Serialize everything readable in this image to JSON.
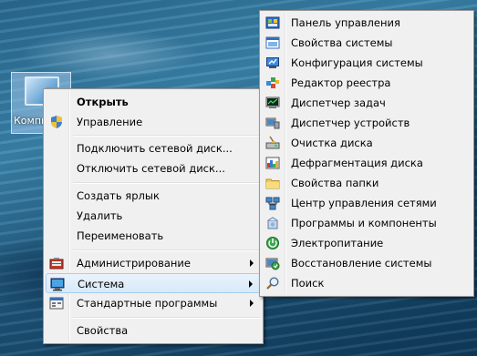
{
  "desktop": {
    "icon_label": "Компьютер"
  },
  "context_menu": {
    "items": [
      {
        "label": "Открыть",
        "bold": true
      },
      {
        "label": "Управление",
        "icon": "shield-icon"
      },
      {
        "label": "Подключить сетевой диск..."
      },
      {
        "label": "Отключить сетевой диск..."
      },
      {
        "label": "Создать ярлык"
      },
      {
        "label": "Удалить"
      },
      {
        "label": "Переименовать"
      },
      {
        "label": "Администрирование",
        "icon": "admin-tools-icon",
        "submenu": true
      },
      {
        "label": "Система",
        "icon": "system-icon",
        "submenu": true,
        "highlighted": true
      },
      {
        "label": "Стандартные программы",
        "icon": "accessories-icon",
        "submenu": true
      },
      {
        "label": "Свойства"
      }
    ]
  },
  "system_submenu": {
    "items": [
      {
        "label": "Панель управления",
        "icon": "control-panel-icon"
      },
      {
        "label": "Свойства системы",
        "icon": "system-properties-icon"
      },
      {
        "label": "Конфигурация системы",
        "icon": "msconfig-icon"
      },
      {
        "label": "Редактор реестра",
        "icon": "registry-editor-icon"
      },
      {
        "label": "Диспетчер задач",
        "icon": "task-manager-icon"
      },
      {
        "label": "Диспетчер устройств",
        "icon": "device-manager-icon"
      },
      {
        "label": "Очистка диска",
        "icon": "disk-cleanup-icon"
      },
      {
        "label": "Дефрагментация диска",
        "icon": "defrag-icon"
      },
      {
        "label": "Свойства папки",
        "icon": "folder-options-icon"
      },
      {
        "label": "Центр управления сетями",
        "icon": "network-center-icon"
      },
      {
        "label": "Программы и компоненты",
        "icon": "programs-icon"
      },
      {
        "label": "Электропитание",
        "icon": "power-options-icon"
      },
      {
        "label": "Восстановление системы",
        "icon": "system-restore-icon"
      },
      {
        "label": "Поиск",
        "icon": "search-icon"
      }
    ]
  },
  "colors": {
    "menu_bg": "#f0f0f0",
    "highlight": "#d8e9f9",
    "highlight_border": "#a8cdf2"
  }
}
